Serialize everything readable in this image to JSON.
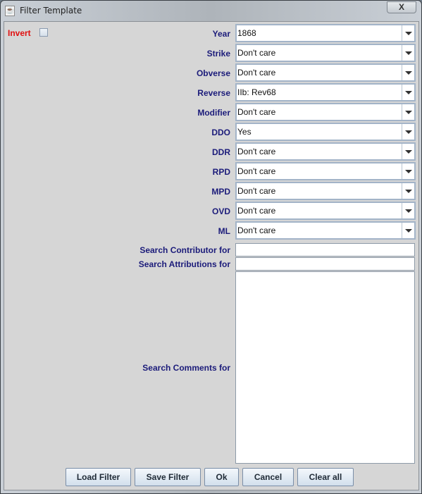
{
  "window": {
    "title": "Filter Template",
    "close_label": "X"
  },
  "invert": {
    "label": "Invert",
    "checked": false
  },
  "combos": [
    {
      "label": "Year",
      "value": "1868"
    },
    {
      "label": "Strike",
      "value": "Don't care"
    },
    {
      "label": "Obverse",
      "value": "Don't care"
    },
    {
      "label": "Reverse",
      "value": "IIb: Rev68"
    },
    {
      "label": "Modifier",
      "value": "Don't care"
    },
    {
      "label": "DDO",
      "value": "Yes"
    },
    {
      "label": "DDR",
      "value": "Don't care"
    },
    {
      "label": "RPD",
      "value": "Don't care"
    },
    {
      "label": "MPD",
      "value": "Don't care"
    },
    {
      "label": "OVD",
      "value": "Don't care"
    },
    {
      "label": "ML",
      "value": "Don't care"
    }
  ],
  "search": {
    "contributor_label": "Search Contributor for",
    "contributor_value": "",
    "attributions_label": "Search Attributions for",
    "attributions_value": "",
    "comments_label": "Search Comments for",
    "comments_value": ""
  },
  "buttons": {
    "load": "Load Filter",
    "save": "Save Filter",
    "ok": "Ok",
    "cancel": "Cancel",
    "clear": "Clear all"
  }
}
